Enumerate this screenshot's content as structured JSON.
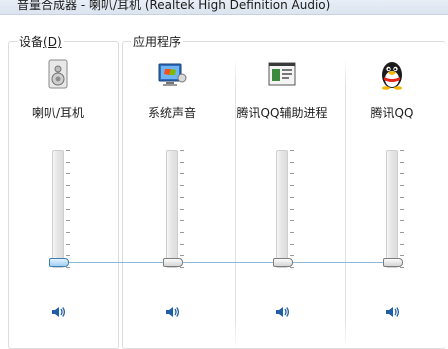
{
  "window": {
    "title": "音量合成器 - 喇叭/耳机 (Realtek High Definition Audio)"
  },
  "device_group": {
    "label": "设备",
    "accelerator": "(D)"
  },
  "apps_group": {
    "label": "应用程序"
  },
  "channels": [
    {
      "label": "喇叭/耳机",
      "icon": "speaker-icon",
      "level": 0,
      "active": true
    },
    {
      "label": "系统声音",
      "icon": "system-sounds-icon",
      "level": 0,
      "active": false
    },
    {
      "label": "腾讯QQ辅助进程",
      "icon": "qq-helper-process-icon",
      "level": 0,
      "active": false
    },
    {
      "label": "腾讯QQ",
      "icon": "qq-penguin-icon",
      "level": 0,
      "active": false
    }
  ],
  "colors": {
    "accent": "#3c7fb1",
    "mute_icon": "#1f5fa8"
  }
}
